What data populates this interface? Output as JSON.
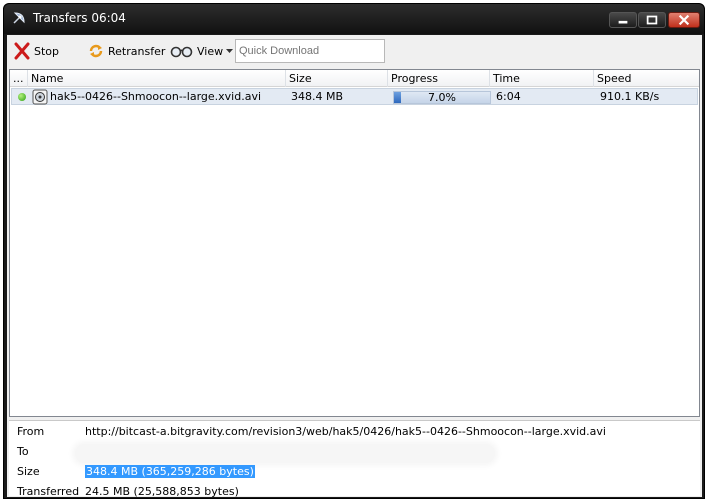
{
  "window": {
    "title": "Transfers 06:04"
  },
  "toolbar": {
    "stop_label": "Stop",
    "retransfer_label": "Retransfer",
    "view_label": "View",
    "quick_download_placeholder": "Quick Download"
  },
  "columns": {
    "extra": "...",
    "name": "Name",
    "size": "Size",
    "progress": "Progress",
    "time": "Time",
    "speed": "Speed"
  },
  "transfers": [
    {
      "name": "hak5--0426--Shmoocon--large.xvid.avi",
      "size": "348.4 MB",
      "progress_text": "7.0%",
      "progress_fraction": 0.07,
      "time": "6:04",
      "speed": "910.1 KB/s"
    }
  ],
  "details": {
    "from_label": "From",
    "from_value": "http://bitcast-a.bitgravity.com/revision3/web/hak5/0426/hak5--0426--Shmoocon--large.xvid.avi",
    "to_label": "To",
    "size_label": "Size",
    "size_value": "348.4 MB (365,259,286 bytes)",
    "transferred_label": "Transferred",
    "transferred_value": "24.5 MB (25,588,853 bytes)"
  },
  "colors": {
    "titlebar": "#1a1a1a",
    "selection": "#3399ff",
    "progress_fill": "#2d68bd",
    "close_button": "#c0301c"
  },
  "icons": {
    "app": "satellite-dish-icon",
    "stop": "red-x-icon",
    "retransfer": "refresh-arrows-icon",
    "view": "glasses-icon",
    "file": "media-file-icon",
    "status": "green-status-dot-icon"
  }
}
